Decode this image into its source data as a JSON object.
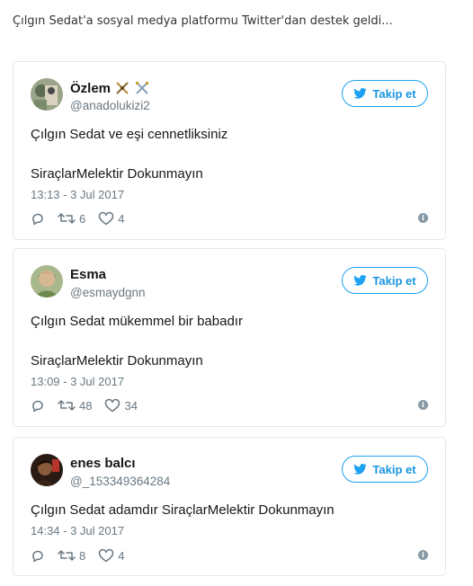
{
  "intro": "Çılgın Sedat'a sosyal medya platformu Twitter'dan destek geldi...",
  "follow_label": "Takip et",
  "colors": {
    "twitter_blue": "#1da1f2",
    "text": "#14171a",
    "muted": "#697882",
    "border": "#e1e8ed"
  },
  "tweets": [
    {
      "name": "Özlem",
      "name_emojis": [
        "crossed-swords-icon",
        "crossed-swords-icon"
      ],
      "handle": "@anadolukizi2",
      "lines": [
        "Çılgın Sedat ve eşi cennetliksiniz",
        "SiraçlarMelektir Dokunmayın"
      ],
      "time": "13:13 - 3 Jul 2017",
      "retweets": "6",
      "likes": "4"
    },
    {
      "name": "Esma",
      "handle": "@esmaydgnn",
      "lines": [
        "Çılgın Sedat mükemmel bir babadır",
        "SiraçlarMelektir Dokunmayın"
      ],
      "time": "13:09 - 3 Jul 2017",
      "retweets": "48",
      "likes": "34"
    },
    {
      "name": "enes balcı",
      "handle": "@_153349364284",
      "lines": [
        "Çılgın Sedat adamdır SiraçlarMelektir Dokunmayın"
      ],
      "time": "14:34 - 3 Jul 2017",
      "retweets": "8",
      "likes": "4"
    }
  ]
}
